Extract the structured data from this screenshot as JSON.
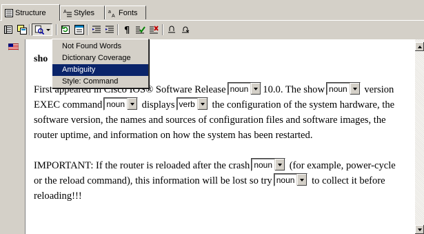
{
  "tabs": [
    {
      "label": "Structure",
      "icon": "structure-icon",
      "active": true
    },
    {
      "label": "Styles",
      "icon": "styles-icon",
      "active": false
    },
    {
      "label": "Fonts",
      "icon": "fonts-icon",
      "active": false
    }
  ],
  "toolbar": {
    "icons": [
      "document-view-icon",
      "copy-icon",
      "check-dropdown-icon",
      "refresh-icon",
      "list-view-icon",
      "indent-left-icon",
      "indent-right-icon",
      "pilcrow-icon",
      "accept-icon",
      "reject-icon",
      "undo-icon",
      "redo-icon"
    ]
  },
  "menu": {
    "items": [
      "Not Found Words",
      "Dictionary Coverage",
      "Ambiguity",
      "Style: Command"
    ],
    "highlighted": "Ambiguity"
  },
  "document": {
    "title_fragment": "sho",
    "para1_a": "First appeared in Cisco IOS® Software Release",
    "combo1": "noun",
    "para1_b": "10.0. The show",
    "combo2": "noun",
    "para1_c": "version EXEC command",
    "combo3": "noun",
    "para1_d": "displays",
    "combo4": "verb",
    "para1_e": "the configuration of the system hardware, the software version, the names and sources of configuration files and software images, the router uptime, and information on how the system has been restarted.",
    "para2_a": "IMPORTANT: If the router is reloaded after the crash",
    "combo5": "noun",
    "para2_b": "(for example, power-cycle or the reload command), this information will be lost so try",
    "combo6": "noun",
    "para2_c": "to collect it before reloading!!!"
  },
  "colors": {
    "highlight": "#0a246a",
    "face": "#d4d0c8"
  }
}
